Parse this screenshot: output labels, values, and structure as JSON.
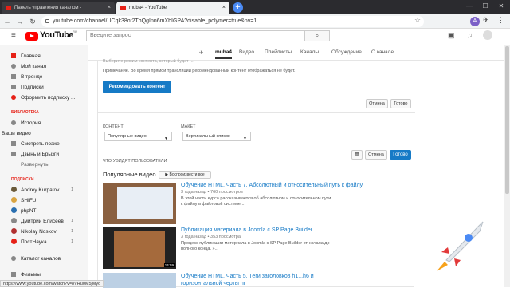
{
  "browser": {
    "tabs": [
      {
        "title": "Панель управления каналом -",
        "close": "×"
      },
      {
        "title": "muba4 - YouTube",
        "close": "×"
      }
    ],
    "new_tab": "+",
    "url": "youtube.com/channel/UCqk38ot2ThQgInn6mXbIGPA?disable_polymer=true&nv=1",
    "avatar_letter": "A",
    "status_url": "https://www.youtube.com/watch?v=8VRu0M5jMyo"
  },
  "youtube": {
    "logo_text": "YouTube",
    "logo_region": "RU",
    "search_placeholder": "Введите запрос"
  },
  "sidebar": {
    "main": [
      "Главная",
      "Мой канал",
      "В тренде",
      "Подписки",
      "Оформить подписку ..."
    ],
    "library_title": "БИБЛИОТЕКА",
    "library": [
      "История",
      "Ваши видео",
      "Смотреть позже",
      "Дзынь и Брызги",
      "Развернуть"
    ],
    "subs_title": "ПОДПИСКИ",
    "subs": [
      {
        "name": "Andrey Kurpatov",
        "count": "1",
        "color": "#6b5a3a"
      },
      {
        "name": "SHIFU",
        "count": "",
        "color": "#d9a441"
      },
      {
        "name": "phpNT",
        "count": "",
        "color": "#2a6fb0"
      },
      {
        "name": "Дмитрий Елисеев",
        "count": "1",
        "color": "#888888"
      },
      {
        "name": "Nikolay Noskov",
        "count": "1",
        "color": "#b03030"
      },
      {
        "name": "ПостНаука",
        "count": "1",
        "color": "#e62117"
      }
    ],
    "extra": [
      "Каталог каналов",
      "Фильмы"
    ]
  },
  "channel_tabs": [
    "muba4",
    "Видео",
    "Плейлисты",
    "Каналы",
    "Обсуждение",
    "О канале"
  ],
  "panel": {
    "top_cut": "Выберите режим контента, который будет ...",
    "note": "Примечание. Во время прямой трансляции рекомендованный контент отображаться не будет.",
    "recommend_btn": "Рекомендовать контент",
    "cancel": "Отмена",
    "done": "Готово",
    "content_label": "КОНТЕНТ",
    "content_value": "Популярные видео",
    "layout_label": "МАКЕТ",
    "layout_value": "Вертикальный список",
    "viewer_label": "ЧТО УВИДЯТ ПОЛЬЗОВАТЕЛИ",
    "popular_title": "Популярные видео",
    "play_all": "▶ Воспроизвести все"
  },
  "videos": [
    {
      "title": "Обучение HTML. Часть 7. Абсолютный и относительный путь к файлу",
      "meta": "3 года назад • 760 просмотров",
      "desc": "В этой части курса рассказывается об абсолютном и относительном пути к файлу в файловой системе..."
    },
    {
      "title": "Публикация материала в Joomla с SP Page Builder",
      "meta": "3 года назад • 353 просмотра",
      "desc": "Процесс публикации материала в Joomla c SP Page Builder от начала до полного конца. »...",
      "duration": "14:59"
    },
    {
      "title": "Обучение HTML. Часть 5. Теги заголовков h1...h6 и горизонтальной черты hr",
      "meta": "",
      "desc": ""
    }
  ],
  "colors": {
    "youtube_red": "#ff0000",
    "accent_blue": "#167ac6",
    "section_red": "#e62117"
  }
}
